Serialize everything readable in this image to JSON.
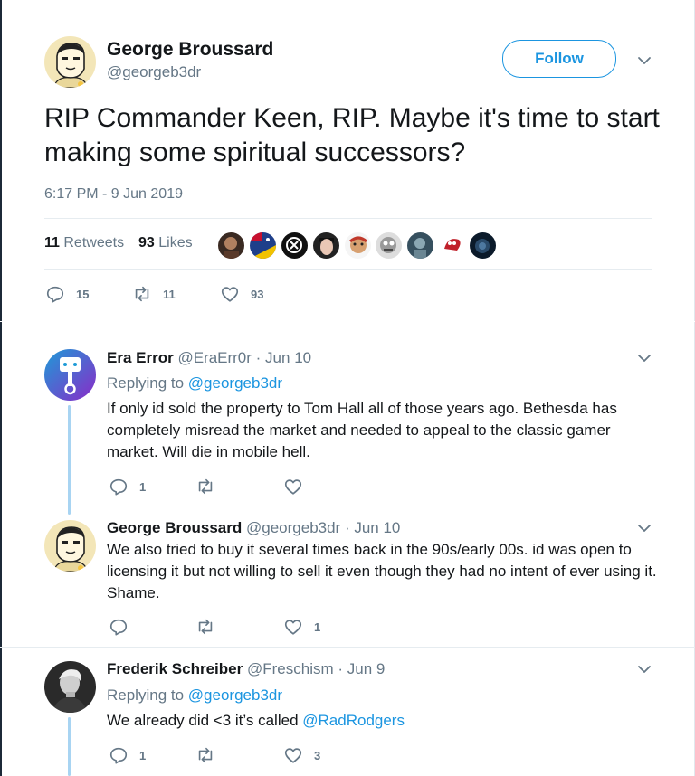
{
  "tweet": {
    "author_name": "George Broussard",
    "author_handle": "@georgeb3dr",
    "follow_label": "Follow",
    "text": "RIP Commander Keen, RIP. Maybe it's time to start making some spiritual successors?",
    "timestamp": "6:17 PM - 9 Jun 2019",
    "retweets_count": "11",
    "retweets_label": "Retweets",
    "likes_count": "93",
    "likes_label": "Likes",
    "actions": {
      "replies": "15",
      "retweets": "11",
      "likes": "93"
    }
  },
  "replies": [
    {
      "name": "Era Error",
      "handle": "@EraErr0r",
      "date": "· Jun 10",
      "replying_to_label": "Replying to",
      "replying_to_handle": "@georgeb3dr",
      "text": "If only id sold the property to Tom Hall all of those years ago. Bethesda has completely misread the market and needed to appeal to the classic gamer market. Will die in mobile hell.",
      "reply_count": "1",
      "retweet_count": "",
      "like_count": ""
    },
    {
      "name": "George Broussard",
      "handle": "@georgeb3dr",
      "date": "· Jun 10",
      "text": "We also tried to buy it several times back in the 90s/early 00s. id was open to licensing it but not willing to sell it even though they had no intent of ever using it. Shame.",
      "reply_count": "",
      "retweet_count": "",
      "like_count": "1"
    },
    {
      "name": "Frederik Schreiber",
      "handle": "@Freschism",
      "date": "· Jun 9",
      "replying_to_label": "Replying to",
      "replying_to_handle": "@georgeb3dr",
      "text_prefix": "We already did <3 it’s called",
      "text_mention": "@RadRodgers",
      "reply_count": "1",
      "retweet_count": "",
      "like_count": "3"
    }
  ],
  "colors": {
    "accent": "#1b95e0",
    "muted": "#657786",
    "text": "#14171a",
    "thread_line": "#a8d4f2",
    "divider": "#e6ecf0"
  },
  "icons": {
    "reply": "reply-icon",
    "retweet": "retweet-icon",
    "like": "heart-icon",
    "more": "chevron-down-icon"
  }
}
